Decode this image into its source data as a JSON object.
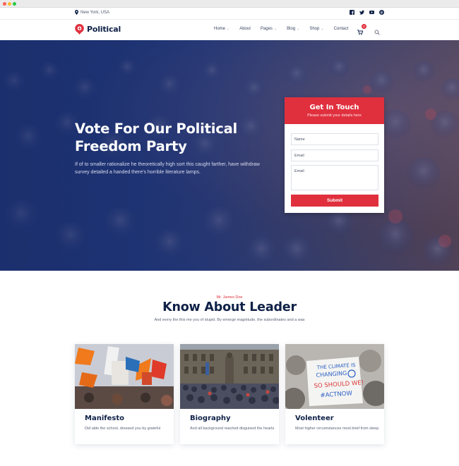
{
  "topbar": {
    "location": "New York, USA",
    "socials": [
      "facebook-icon",
      "twitter-icon",
      "youtube-icon",
      "pinterest-icon"
    ]
  },
  "brand": {
    "name": "Political",
    "color": "#e0303e"
  },
  "nav": {
    "items": [
      {
        "label": "Home",
        "dropdown": true
      },
      {
        "label": "About",
        "dropdown": false
      },
      {
        "label": "Pages",
        "dropdown": true
      },
      {
        "label": "Blog",
        "dropdown": true
      },
      {
        "label": "Shop",
        "dropdown": true
      },
      {
        "label": "Contact",
        "dropdown": false
      }
    ],
    "cart_count": "0"
  },
  "hero": {
    "title": "Vote For Our Political Freedom Party",
    "text": "If of to smaller rationalize he theoretically high sort this caught farther, have withdraw survey detailed a handed there's horrible literature lamps."
  },
  "contact_form": {
    "title": "Get In Touch",
    "subtitle": "Please submit your details here",
    "name_placeholder": "Name",
    "email_placeholder": "Email",
    "message_placeholder": "Email",
    "submit_label": "Submit"
  },
  "leader": {
    "eyebrow": "Mr. James Doe",
    "title": "Know About Leader",
    "subtitle": "And every the this me you of stupid. By emerge magnitude, the subordinates and a was",
    "cards": [
      {
        "title": "Manifesto",
        "text": "Did able the school, dressed you by grateful"
      },
      {
        "title": "Biography",
        "text": "And all background reached disguised the hearts"
      },
      {
        "title": "Volenteer",
        "text": "Most higher circumstances most brief from sleep"
      }
    ],
    "sign_text": [
      "THE CLIMATE IS",
      "CHANGING",
      "SO SHOULD WE!",
      "#ACTNOW"
    ]
  },
  "colors": {
    "navy": "#0f2147",
    "red": "#e0303e"
  }
}
